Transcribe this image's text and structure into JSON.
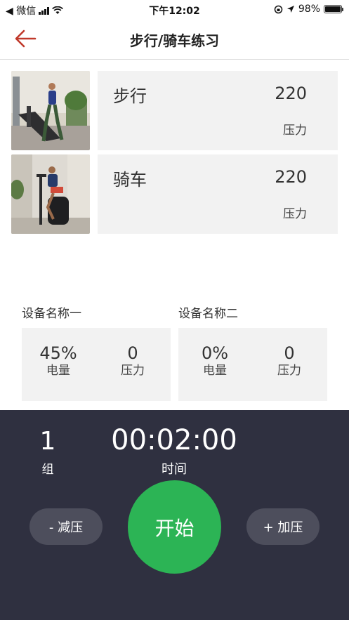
{
  "status_bar": {
    "back_app": "◀ 微信",
    "time": "下午12:02",
    "battery": "98%",
    "battery_level": 0.98
  },
  "nav": {
    "title": "步行/骑车练习"
  },
  "exercises": [
    {
      "name": "步行",
      "value": "220",
      "unit": "压力"
    },
    {
      "name": "骑车",
      "value": "220",
      "unit": "压力"
    }
  ],
  "devices": [
    {
      "name": "设备名称一",
      "battery_value": "45%",
      "battery_label": "电量",
      "pressure_value": "0",
      "pressure_label": "压力"
    },
    {
      "name": "设备名称二",
      "battery_value": "0%",
      "battery_label": "电量",
      "pressure_value": "0",
      "pressure_label": "压力"
    }
  ],
  "control": {
    "group_value": "1",
    "group_label": "组",
    "timer_value": "00:02:00",
    "timer_label": "时间",
    "decrease_label": "- 减压",
    "start_label": "开始",
    "increase_label": "+ 加压"
  },
  "colors": {
    "accent_back": "#c0392b",
    "panel_bg": "#2f3040",
    "start_green": "#2cb455",
    "card_bg": "#f2f2f2"
  }
}
